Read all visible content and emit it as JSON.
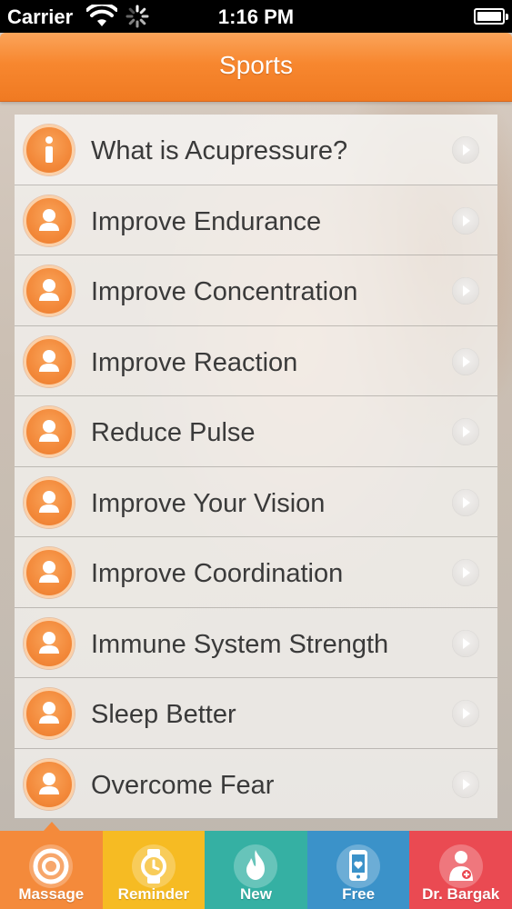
{
  "status_bar": {
    "carrier": "Carrier",
    "time": "1:16 PM"
  },
  "nav": {
    "title": "Sports"
  },
  "list": {
    "items": [
      {
        "label": "What is Acupressure?",
        "icon": "info-icon"
      },
      {
        "label": "Improve Endurance",
        "icon": "person-icon"
      },
      {
        "label": "Improve Concentration",
        "icon": "person-icon"
      },
      {
        "label": "Improve Reaction",
        "icon": "person-icon"
      },
      {
        "label": "Reduce Pulse",
        "icon": "person-icon"
      },
      {
        "label": "Improve Your Vision",
        "icon": "person-icon"
      },
      {
        "label": "Improve Coordination",
        "icon": "person-icon"
      },
      {
        "label": "Immune System Strength",
        "icon": "person-icon"
      },
      {
        "label": "Sleep Better",
        "icon": "person-icon"
      },
      {
        "label": "Overcome Fear",
        "icon": "person-icon"
      }
    ]
  },
  "tabs": [
    {
      "label": "Massage",
      "icon": "target-icon",
      "color": "#f48a3b",
      "selected": true
    },
    {
      "label": "Reminder",
      "icon": "watch-icon",
      "color": "#f6bb23",
      "selected": false
    },
    {
      "label": "New",
      "icon": "flame-icon",
      "color": "#35b0a3",
      "selected": false
    },
    {
      "label": "Free",
      "icon": "phone-heart-icon",
      "color": "#3b92c9",
      "selected": false
    },
    {
      "label": "Dr. Bargak",
      "icon": "doctor-icon",
      "color": "#ea4a52",
      "selected": false
    }
  ],
  "colors": {
    "nav_orange": "#f7872f",
    "accent_orange": "#f48a3b"
  }
}
